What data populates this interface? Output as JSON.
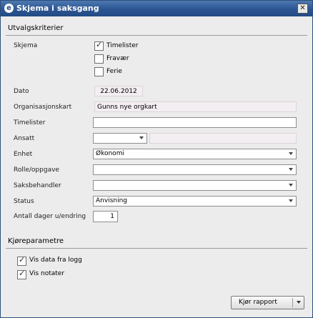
{
  "window": {
    "title": "Skjema i saksgang",
    "icon": "app-logo-icon",
    "close_glyph": "✕"
  },
  "criteria": {
    "header": "Utvalgskriterier",
    "skjema_label": "Skjema",
    "skjema_options": [
      {
        "label": "Timelister",
        "checked": true
      },
      {
        "label": "Fravær",
        "checked": false
      },
      {
        "label": "Ferie",
        "checked": false
      }
    ],
    "dato_label": "Dato",
    "dato_value": "22.06.2012",
    "org_label": "Organisasjonskart",
    "org_value": "Gunns nye orgkart",
    "timelister_label": "Timelister",
    "timelister_value": "",
    "ansatt_label": "Ansatt",
    "ansatt_value": "",
    "ansatt_name": "",
    "enhet_label": "Enhet",
    "enhet_value": "Økonomi",
    "rolle_label": "Rolle/oppgave",
    "rolle_value": "",
    "saksbehandler_label": "Saksbehandler",
    "saksbehandler_value": "",
    "status_label": "Status",
    "status_value": "Anvisning",
    "dager_label": "Antall dager u/endring",
    "dager_value": "1"
  },
  "run_params": {
    "header": "Kjøreparametre",
    "options": [
      {
        "label": "Vis data fra logg",
        "checked": true
      },
      {
        "label": "Vis notater",
        "checked": true
      }
    ]
  },
  "footer": {
    "run_button": "Kjør rapport"
  }
}
